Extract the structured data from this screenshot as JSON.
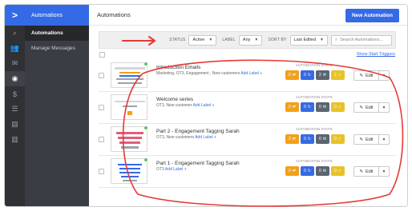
{
  "rail": {
    "logo_icon": "chevron-right-logo",
    "items": [
      {
        "name": "search",
        "glyph": "⌕"
      },
      {
        "name": "contacts",
        "glyph": "👥"
      },
      {
        "name": "campaigns",
        "glyph": "✉"
      },
      {
        "name": "automations",
        "glyph": "◉"
      },
      {
        "name": "deals",
        "glyph": "$"
      },
      {
        "name": "lists",
        "glyph": "☰"
      },
      {
        "name": "forms",
        "glyph": "▤"
      },
      {
        "name": "reports",
        "glyph": "▥"
      }
    ]
  },
  "nav": {
    "header": "Automations",
    "items": [
      "Automations",
      "Manage Messages"
    ]
  },
  "header": {
    "title": "Automations",
    "new_button": "New Automation"
  },
  "filters": {
    "status_label": "STATUS",
    "status_value": "Active",
    "label_label": "LABEL",
    "label_value": "Any",
    "sort_label": "SORT BY",
    "sort_value": "Last Edited",
    "search_placeholder": "Search Automations..."
  },
  "list": {
    "show_triggers": "Show Start Triggers",
    "stats_heading": "AUTOMATION STATS",
    "edit_label": "Edit",
    "rows": [
      {
        "title": "Introduction Emails",
        "tags": "Marketing, OT3, Engagement , New customers",
        "add_label": "Add Label +",
        "active": true,
        "stats": [
          "0",
          "0",
          "2",
          "2"
        ]
      },
      {
        "title": "Welcome series",
        "tags": "OT3, New customer",
        "add_label": "Add Label +",
        "active": false,
        "stats": [
          "0",
          "0",
          "0",
          "0"
        ]
      },
      {
        "title": "Part 2 - Engagement Tagging Sarah",
        "tags": "OT3, New customers",
        "add_label": "Add Label +",
        "active": true,
        "stats": [
          "2",
          "0",
          "0",
          "0"
        ]
      },
      {
        "title": "Part 1 - Engagement Tagging Sarah",
        "tags": "OT3",
        "add_label": "Add Label +",
        "active": true,
        "stats": [
          "0",
          "0",
          "0",
          "0"
        ]
      }
    ]
  },
  "colors": {
    "brand_blue": "#356ae6",
    "annotation_red": "#e53935",
    "stat_orange": "#f3a01b",
    "stat_dark": "#5b6570",
    "stat_yellow": "#e8c22a",
    "active_green": "#5cc06b"
  }
}
